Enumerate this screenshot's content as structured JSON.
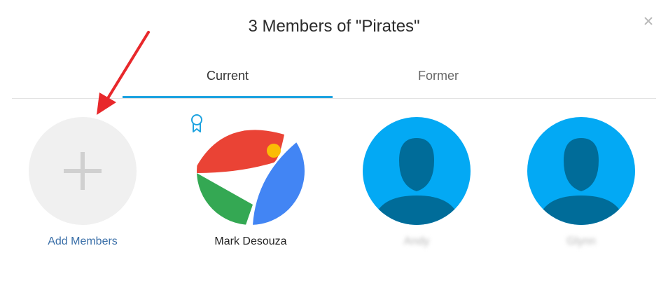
{
  "dialog": {
    "title": "3 Members of \"Pirates\"",
    "close_icon": "close-icon"
  },
  "tabs": [
    {
      "label": "Current",
      "active": true
    },
    {
      "label": "Former",
      "active": false
    }
  ],
  "colors": {
    "accent": "#1ea3e0",
    "link": "#3a6fa8",
    "placeholder_avatar_bg": "#03a9f4",
    "placeholder_avatar_silhouette": "#006c99",
    "annotation_arrow": "#e8282b"
  },
  "members": [
    {
      "name": "Add Members",
      "icon": "plus-icon"
    },
    {
      "name": "Mark Desouza",
      "icon": "google-style-avatar",
      "badge_icon": "ribbon-badge-icon"
    },
    {
      "name": "Andy",
      "icon": "default-user-avatar"
    },
    {
      "name": "Glynn",
      "icon": "default-user-avatar"
    }
  ]
}
